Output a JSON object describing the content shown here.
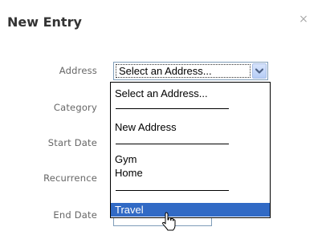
{
  "dialog": {
    "title": "New Entry",
    "close_label": "×"
  },
  "form": {
    "labels": {
      "address": "Address",
      "category": "Category",
      "start_date": "Start Date",
      "recurrence": "Recurrence",
      "end_date": "End Date"
    },
    "address_select": {
      "value": "Select an Address...",
      "options": [
        "Select an Address...",
        "New Address",
        "Gym",
        "Home",
        "Travel"
      ],
      "highlighted": "Travel"
    }
  },
  "icons": {
    "dropdown_arrow": "chevron-down-icon",
    "cursor": "pointer-cursor-icon",
    "close": "close-icon"
  },
  "colors": {
    "highlight": "#316ac5",
    "select_border": "#7f9db9",
    "label_text": "#666666"
  }
}
